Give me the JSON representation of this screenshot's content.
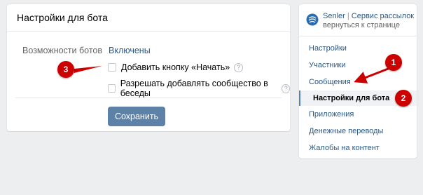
{
  "main_card": {
    "title": "Настройки для бота",
    "bots_label": "Возможности ботов",
    "bots_value": "Включены",
    "checkbox_start_label": "Добавить кнопку «Начать»",
    "checkbox_chats_label": "Разрешать добавлять сообщество в беседы",
    "help_glyph": "?",
    "save_button": "Сохранить"
  },
  "sidebar": {
    "app_name": "Senler",
    "separator": "|",
    "app_desc": "Сервис рассылок",
    "subtitle": "вернуться к странице",
    "items": [
      {
        "label": "Настройки"
      },
      {
        "label": "Участники"
      },
      {
        "label": "Сообщения"
      },
      {
        "label": "Настройки для бота"
      },
      {
        "label": "Приложения"
      },
      {
        "label": "Денежные переводы"
      },
      {
        "label": "Жалобы на контент"
      }
    ]
  },
  "annotations": {
    "marker_1": "1",
    "marker_2": "2",
    "marker_3": "3"
  },
  "colors": {
    "background": "#edeef0",
    "link": "#2a5885",
    "button": "#5e81a8",
    "marker": "#cc0000"
  }
}
